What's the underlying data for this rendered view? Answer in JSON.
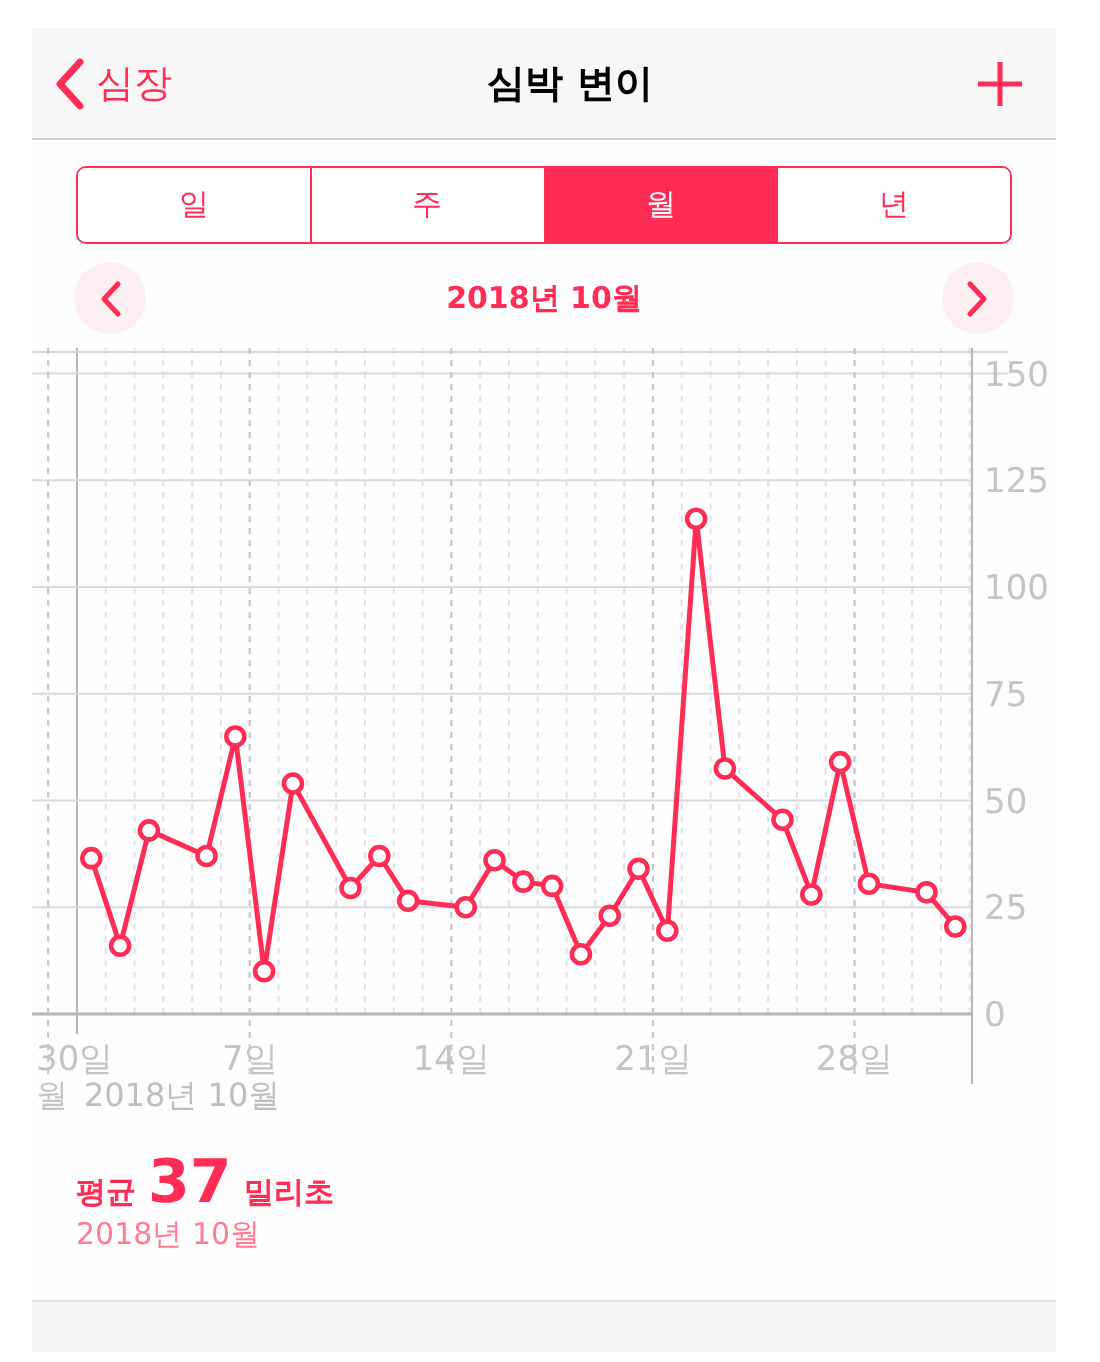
{
  "nav": {
    "back_label": "심장",
    "title": "심박 변이"
  },
  "segments": [
    {
      "label": "일",
      "selected": false
    },
    {
      "label": "주",
      "selected": false
    },
    {
      "label": "월",
      "selected": true
    },
    {
      "label": "년",
      "selected": false
    }
  ],
  "period": {
    "title": "2018년 10월"
  },
  "chart": {
    "previous_month_day_label": "30일",
    "month_label_partial": "월",
    "month_label": "2018년 10월",
    "chart_data": {
      "type": "line",
      "grid": true,
      "x": [
        1.5,
        2.5,
        3.5,
        5.5,
        6.5,
        7.5,
        8.5,
        10.5,
        11.5,
        12.5,
        14.5,
        15.5,
        16.5,
        17.5,
        18.5,
        19.5,
        20.5,
        21.5,
        22.5,
        23.5,
        25.5,
        26.5,
        27.5,
        28.5,
        30.5,
        31.5
      ],
      "ref_lines": [
        {
          "axis": "x",
          "value": 1
        }
      ],
      "series": [
        {
          "color": "#ff2d55",
          "marker": "o",
          "values": [
            36.5,
            16,
            43,
            37,
            65,
            10,
            54,
            29.5,
            37,
            26.5,
            25,
            36,
            31,
            30,
            14,
            23,
            34,
            19.5,
            116,
            57.5,
            45.5,
            28,
            59,
            30.5,
            28.5,
            20.5
          ]
        }
      ],
      "xlim": [
        -0.56,
        32.08
      ],
      "ylim": [
        0,
        156
      ],
      "xticks": [
        {
          "value": 7,
          "label": "7일"
        },
        {
          "value": 14,
          "label": "14일"
        },
        {
          "value": 21,
          "label": "21일"
        },
        {
          "value": 28,
          "label": "28일"
        }
      ],
      "yticks": [
        0,
        25,
        50,
        75,
        100,
        125,
        150
      ]
    }
  },
  "summary": {
    "label": "평균",
    "value": "37",
    "unit": "밀리초",
    "period": "2018년 10월"
  }
}
